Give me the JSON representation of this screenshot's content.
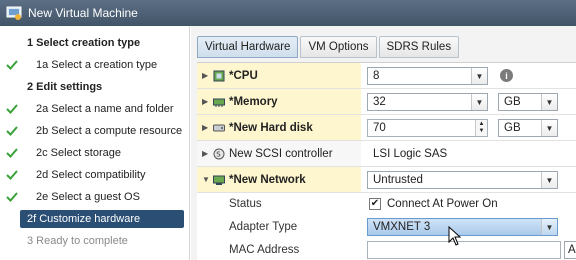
{
  "window": {
    "title": "New Virtual Machine"
  },
  "steps": [
    {
      "label": "1  Select creation type",
      "kind": "header",
      "check": false
    },
    {
      "label": "1a  Select a creation type",
      "kind": "sub",
      "check": true
    },
    {
      "label": "2  Edit settings",
      "kind": "header",
      "check": false
    },
    {
      "label": "2a  Select a name and folder",
      "kind": "sub",
      "check": true
    },
    {
      "label": "2b  Select a compute resource",
      "kind": "sub",
      "check": true
    },
    {
      "label": "2c  Select storage",
      "kind": "sub",
      "check": true
    },
    {
      "label": "2d  Select compatibility",
      "kind": "sub",
      "check": true
    },
    {
      "label": "2e  Select a guest OS",
      "kind": "sub",
      "check": true
    },
    {
      "label": "2f  Customize hardware",
      "kind": "active",
      "check": false
    },
    {
      "label": "3  Ready to complete",
      "kind": "disabled",
      "check": false
    }
  ],
  "tabs": [
    "Virtual Hardware",
    "VM Options",
    "SDRS Rules"
  ],
  "hardware": {
    "cpu": {
      "name": "*CPU",
      "value": "8"
    },
    "memory": {
      "name": "*Memory",
      "value": "32",
      "unit": "GB"
    },
    "hard_disk": {
      "name": "*New Hard disk",
      "value": "70",
      "unit": "GB"
    },
    "scsi": {
      "name": "New SCSI controller",
      "value": "LSI Logic SAS"
    },
    "network": {
      "name": "*New Network",
      "value": "Untrusted",
      "status_label": "Status",
      "status_value": "Connect At Power On",
      "adapter_label": "Adapter Type",
      "adapter_value": "VMXNET 3",
      "mac_label": "MAC Address",
      "mac_value": "",
      "mac_button": "A"
    }
  },
  "colors": {
    "titlebar": "#4d6177",
    "active_step": "#2a4e74",
    "highlight_row": "#fdf6cf",
    "check": "#3aa13a"
  }
}
